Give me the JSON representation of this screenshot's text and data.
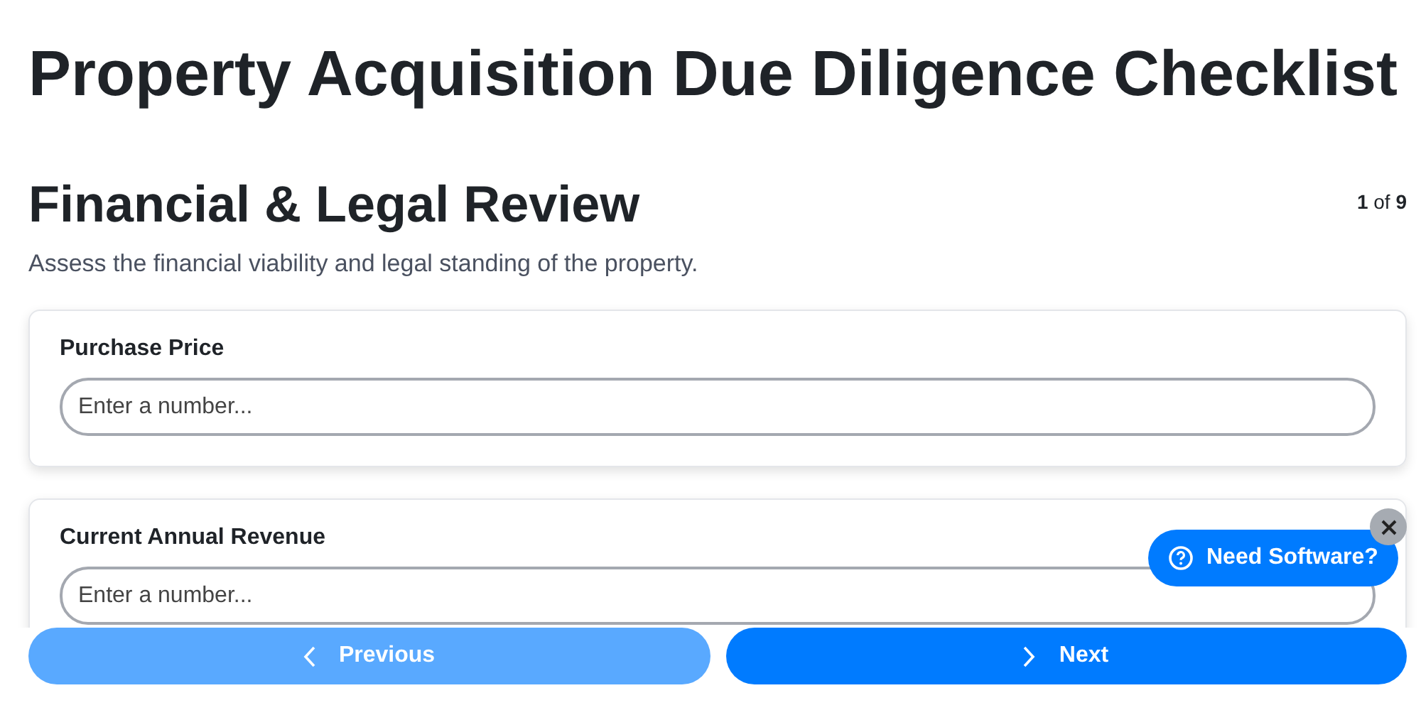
{
  "title": "Property Acquisition Due Diligence Checklist",
  "section": {
    "heading": "Financial & Legal Review",
    "progress": "**1** of **9**",
    "description": "Assess the financial viability and legal standing of the property."
  },
  "fields": [
    {
      "label": "Purchase Price",
      "placeholder": "Enter a number..."
    },
    {
      "label": "Current Annual Revenue",
      "placeholder": "Enter a number..."
    }
  ],
  "navigation": {
    "previous": {
      "label": "Previous",
      "disabled": true
    },
    "next": {
      "label": "Next",
      "disabled": false
    }
  },
  "help_bubble": {
    "label": "Need Software?"
  }
}
